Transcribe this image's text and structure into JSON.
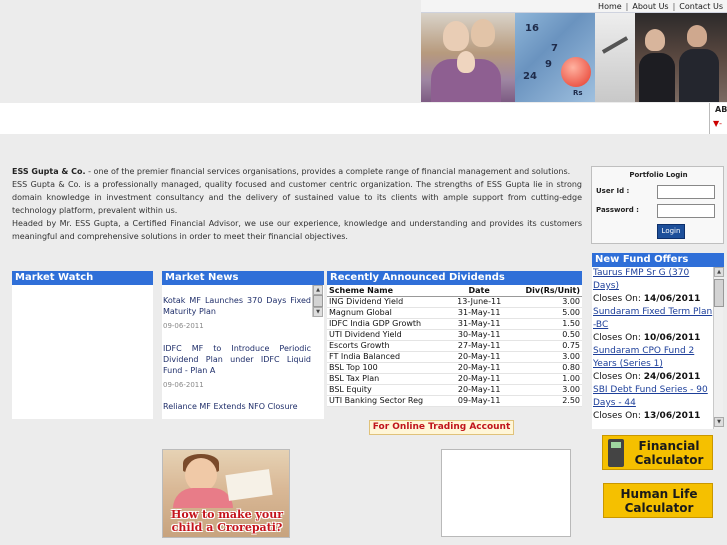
{
  "topnav": {
    "home": "Home",
    "about": "About Us",
    "contact": "Contact Us",
    "separator": "|"
  },
  "banner": {
    "numbers": [
      "16",
      "7",
      "24",
      "9",
      "Rs"
    ]
  },
  "ticker": {
    "top": "AB",
    "bottom": "▼-"
  },
  "intro": {
    "company": "ESS Gupta & Co.",
    "p1": " - one of the premier financial services organisations, provides a complete range of financial management and solutions.",
    "p2": "ESS Gupta & Co. is a professionally managed, quality focused and customer centric organization. The strengths of ESS Gupta lie in strong domain knowledge in investment consultancy and the delivery of sustained value to its clients with ample support from cutting-edge technology platform, prevalent within us.",
    "p3": "Headed by Mr. ESS Gupta, a Certified Financial Advisor, we use our experience, knowledge and understanding and provides its customers meaningful and comprehensive solutions in order to meet their financial objectives."
  },
  "login": {
    "title": "Portfolio Login",
    "user_label": "User Id  :",
    "password_label": "Password :",
    "button": "Login"
  },
  "market_watch": {
    "title": "Market Watch"
  },
  "market_news": {
    "title": "Market News",
    "items": [
      {
        "text": "Kotak MF Launches 370 Days Fixed Maturity Plan",
        "date": "09-06-2011"
      },
      {
        "text": "IDFC MF to Introduce Periodic Dividend Plan under IDFC Liquid Fund - Plan A",
        "date": "09-06-2011"
      },
      {
        "text": "Reliance MF Extends NFO Closure",
        "date": ""
      }
    ]
  },
  "dividends": {
    "title": "Recently Announced Dividends",
    "headers": [
      "Scheme Name",
      "Date",
      "Div(Rs/Unit)"
    ],
    "rows": [
      [
        "ING Dividend Yield",
        "13-June-11",
        "3.00"
      ],
      [
        "Magnum Global",
        "31-May-11",
        "5.00"
      ],
      [
        "IDFC India GDP Growth",
        "31-May-11",
        "1.50"
      ],
      [
        "UTI Dividend Yield",
        "30-May-11",
        "0.50"
      ],
      [
        "Escorts Growth",
        "27-May-11",
        "0.75"
      ],
      [
        "FT India Balanced",
        "20-May-11",
        "3.00"
      ],
      [
        "BSL Top 100",
        "20-May-11",
        "0.80"
      ],
      [
        "BSL Tax Plan",
        "20-May-11",
        "1.00"
      ],
      [
        "BSL Equity",
        "20-May-11",
        "3.00"
      ],
      [
        "UTI Banking Sector Reg",
        "09-May-11",
        "2.50"
      ]
    ]
  },
  "trading": {
    "label": "For Online Trading Account"
  },
  "nfo": {
    "title": "New Fund Offers",
    "closes_label": "Closes On: ",
    "items": [
      {
        "name": "Taurus FMP Sr G (370 Days)",
        "date": "14/06/2011"
      },
      {
        "name": "Sundaram Fixed Term Plan -BC",
        "date": "10/06/2011"
      },
      {
        "name": "Sundaram CPO Fund 2 Years (Series 1)",
        "date": "24/06/2011"
      },
      {
        "name": "SBI Debt Fund Series - 90 Days - 44",
        "date": "13/06/2011"
      }
    ]
  },
  "calculators": {
    "financial": "Financial Calculator",
    "human_life": "Human Life Calculator"
  },
  "promo": {
    "text": "How to make your child a Crorepati?"
  }
}
